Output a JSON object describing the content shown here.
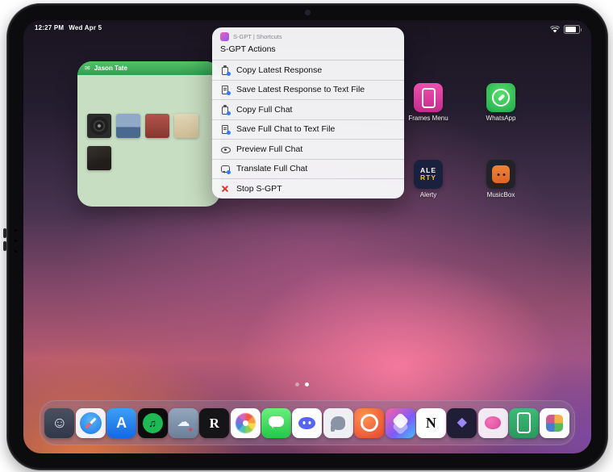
{
  "status_bar": {
    "time": "12:27 PM",
    "date": "Wed Apr 5",
    "icons": [
      "wifi-icon",
      "battery-icon"
    ]
  },
  "widget": {
    "title": "Jason Tate",
    "thumbnail_count": 5
  },
  "menu": {
    "app_header": "S-GPT | Shortcuts",
    "title": "S-GPT Actions",
    "items": [
      {
        "icon": "clipboard-icon",
        "label": "Copy Latest Response"
      },
      {
        "icon": "text-file-icon",
        "label": "Save Latest Response to Text File"
      },
      {
        "icon": "clipboard-icon",
        "label": "Copy Full Chat"
      },
      {
        "icon": "text-file-icon",
        "label": "Save Full Chat to Text File"
      },
      {
        "icon": "eye-icon",
        "label": "Preview Full Chat"
      },
      {
        "icon": "translate-icon",
        "label": "Translate Full Chat"
      },
      {
        "icon": "stop-icon",
        "label": "Stop S-GPT"
      }
    ]
  },
  "home_apps": [
    {
      "id": "frames-menu",
      "label": "Frames Menu"
    },
    {
      "id": "whatsapp",
      "label": "WhatsApp"
    },
    {
      "id": "alerty",
      "label": "Alerty",
      "line1": "ALE",
      "line2": "RTY"
    },
    {
      "id": "musicbox",
      "label": "MusicBox"
    }
  ],
  "page_dots": {
    "count": 2,
    "active_index": 1
  },
  "dock": {
    "apps": [
      {
        "id": "finder",
        "glyph": "☺"
      },
      {
        "id": "safari",
        "glyph": ""
      },
      {
        "id": "appstore",
        "glyph": "A"
      },
      {
        "id": "spotify",
        "glyph": "♫"
      },
      {
        "id": "cloud",
        "glyph": "☁"
      },
      {
        "id": "reader",
        "glyph": "R"
      },
      {
        "id": "photos",
        "glyph": ""
      },
      {
        "id": "messages",
        "glyph": ""
      },
      {
        "id": "discord",
        "glyph": ""
      },
      {
        "id": "mastodon",
        "glyph": ""
      },
      {
        "id": "timer",
        "glyph": ""
      },
      {
        "id": "shortcuts",
        "glyph": ""
      },
      {
        "id": "notion",
        "glyph": "N"
      },
      {
        "id": "obsidian",
        "glyph": "◆"
      },
      {
        "id": "brain",
        "glyph": ""
      },
      {
        "id": "frames",
        "glyph": ""
      },
      {
        "id": "photogrid",
        "glyph": ""
      }
    ]
  },
  "colors": {
    "menu_bg": "#f7f7f9",
    "stop_red": "#e2352b",
    "badge_blue": "#2f7cf6",
    "widget_green": "#2f9e50"
  }
}
